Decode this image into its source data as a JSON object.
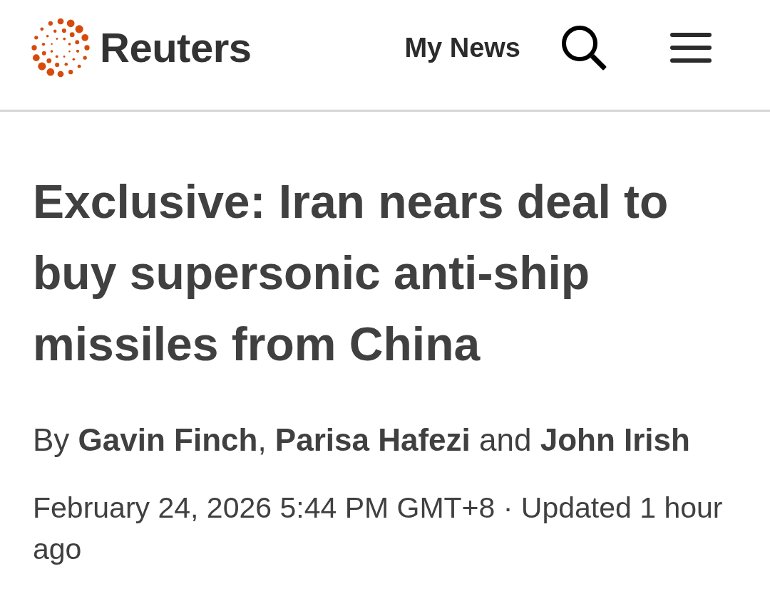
{
  "header": {
    "logo": {
      "text": "Reuters"
    },
    "nav": [
      {
        "label": "My News"
      }
    ]
  },
  "article": {
    "headline": "Exclusive: Iran nears deal to buy supersonic anti-ship missiles from China",
    "byline": "By **Gavin Finch**, **Parisa Hafezi** and **John Irish**",
    "dateline": "February 24, 2026 5:44 PM GMT+8 · Updated 1 hour ago"
  }
}
